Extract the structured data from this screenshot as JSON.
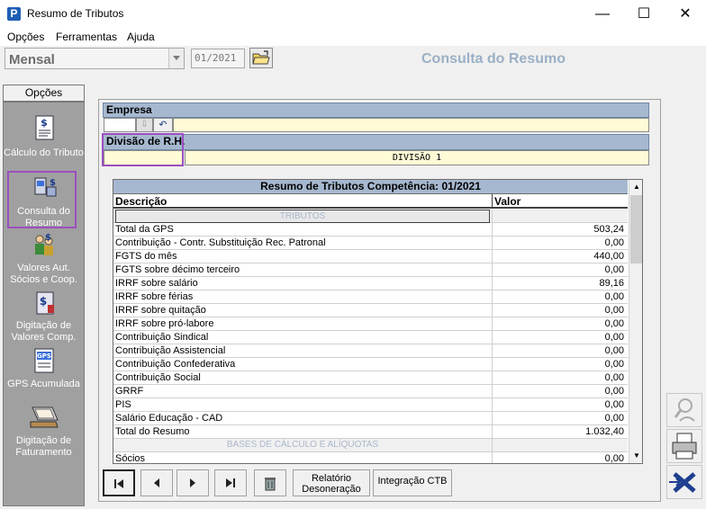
{
  "window": {
    "title": "Resumo de Tributos",
    "icon_letter": "P",
    "minimize": "—",
    "maximize": "☐",
    "close": "✕"
  },
  "menu": [
    "Opções",
    "Ferramentas",
    "Ajuda"
  ],
  "toolbar": {
    "period_value": "Mensal",
    "competencia": "01/2021",
    "header_title": "Consulta do Resumo"
  },
  "sidebar": {
    "tab_label": "Opções",
    "items": [
      {
        "label": "Cálculo do Tributo",
        "icon": "calculator-icon"
      },
      {
        "label": "Consulta do Resumo",
        "icon": "computer-icon"
      },
      {
        "label": "Valores Aut. Sócios e  Coop.",
        "icon": "people-money-icon"
      },
      {
        "label": "Digitação de Valores Comp.",
        "icon": "money-document-icon"
      },
      {
        "label": "GPS Acumulada",
        "icon": "gps-document-icon"
      },
      {
        "label": "Digitação de Faturamento",
        "icon": "laptop-icon"
      }
    ]
  },
  "empresa": {
    "label": "Empresa",
    "code": "",
    "name": ""
  },
  "divisao": {
    "label": "Divisão de R.H.",
    "code": "",
    "name": "DIVISÃO 1"
  },
  "grid": {
    "title": "Resumo de Tributos Competência: 01/2021",
    "col_desc": "Descrição",
    "col_valor": "Valor",
    "rows": [
      {
        "desc": "TRIBUTOS",
        "valor": "",
        "section": true
      },
      {
        "desc": "Total da GPS",
        "valor": "503,24"
      },
      {
        "desc": "Contribuição - Contr. Substituição Rec. Patronal",
        "valor": "0,00"
      },
      {
        "desc": "FGTS do mês",
        "valor": "440,00"
      },
      {
        "desc": "FGTS sobre décimo terceiro",
        "valor": "0,00"
      },
      {
        "desc": "IRRF sobre salário",
        "valor": "89,16"
      },
      {
        "desc": "IRRF sobre férias",
        "valor": "0,00"
      },
      {
        "desc": "IRRF sobre quitação",
        "valor": "0,00"
      },
      {
        "desc": "IRRF sobre pró-labore",
        "valor": "0,00"
      },
      {
        "desc": "Contribuição Sindical",
        "valor": "0,00"
      },
      {
        "desc": "Contribuição Assistencial",
        "valor": "0,00"
      },
      {
        "desc": "Contribuição Confederativa",
        "valor": "0,00"
      },
      {
        "desc": "Contribuição Social",
        "valor": "0,00"
      },
      {
        "desc": "GRRF",
        "valor": "0,00"
      },
      {
        "desc": "PIS",
        "valor": "0,00"
      },
      {
        "desc": "Salário Educação - CAD",
        "valor": "0,00"
      },
      {
        "desc": "Total do Resumo",
        "valor": "1.032,40"
      },
      {
        "desc": "BASES DE CÁLCULO E ALÍQUOTAS",
        "valor": "",
        "section": true
      },
      {
        "desc": "Sócios",
        "valor": "0,00"
      }
    ]
  },
  "nav": {
    "relatorio_label": "Relatório Desoneração",
    "integracao_label": "Integração CTB"
  },
  "colors": {
    "header_blue": "#a6b8cf",
    "highlight_purple": "#9b4fbf",
    "sidebar_gray": "#a0a0a0",
    "yellow_field": "#fffbd6"
  }
}
